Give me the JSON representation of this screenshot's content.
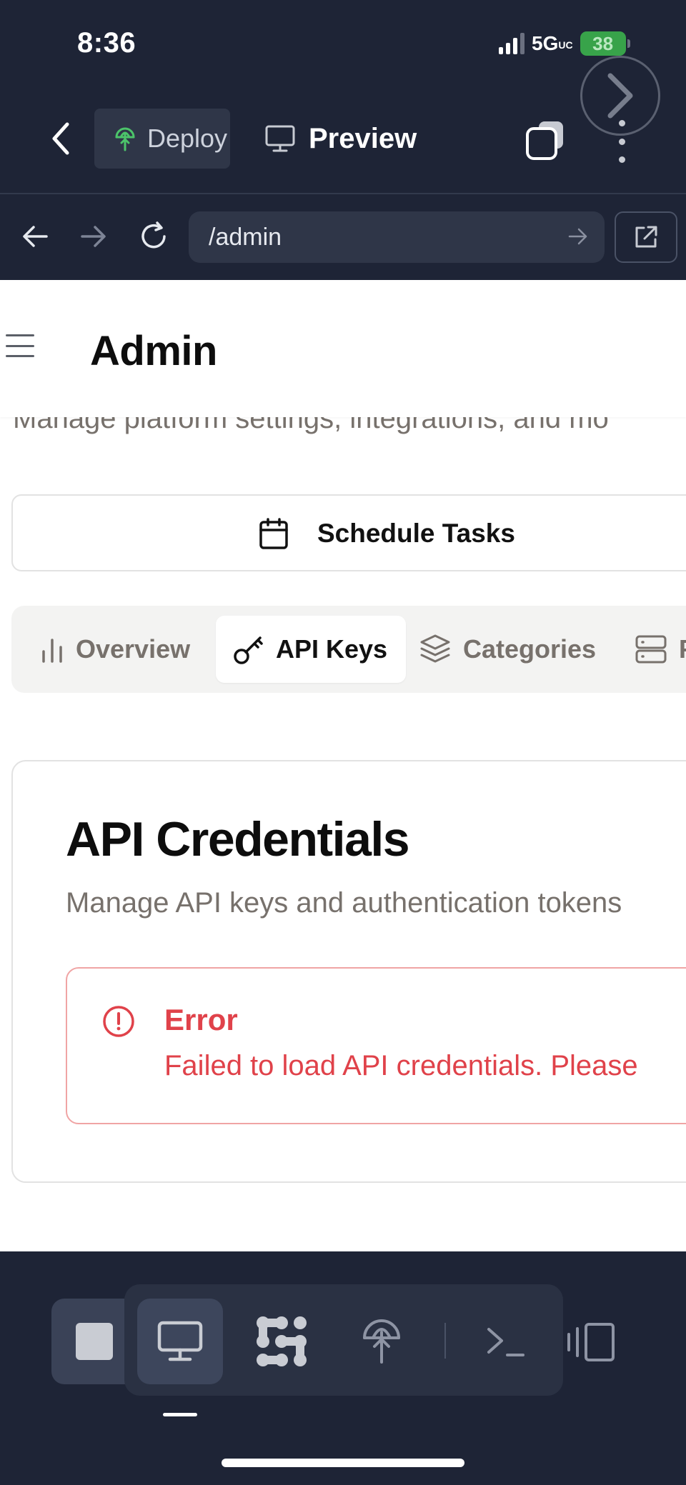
{
  "status_bar": {
    "time": "8:36",
    "network": "5G",
    "network_suffix": "UC",
    "battery": "38"
  },
  "top_bar": {
    "deploy_label": "Deploy",
    "preview_label": "Preview"
  },
  "url_bar": {
    "url": "/admin"
  },
  "page": {
    "title": "Admin",
    "subtitle": "Manage platform settings, integrations, and mo",
    "schedule_button": "Schedule Tasks",
    "tabs": [
      {
        "label": "Overview",
        "icon": "bar-chart-icon"
      },
      {
        "label": "API Keys",
        "icon": "key-icon"
      },
      {
        "label": "Categories",
        "icon": "layers-icon"
      },
      {
        "label": "P",
        "icon": "server-icon"
      }
    ],
    "card": {
      "title": "API Credentials",
      "description": "Manage API keys and authentication tokens",
      "alert_title": "Error",
      "alert_message": "Failed to load API credentials. Please"
    }
  },
  "dock": {
    "items": [
      "stop-icon",
      "monitor-icon",
      "ai-agent-icon",
      "deploy-icon",
      "terminal-icon",
      "split-view-icon"
    ]
  },
  "colors": {
    "chrome_bg": "#1e2436",
    "error_red": "#e0424a",
    "deploy_green": "#4cc46a"
  }
}
